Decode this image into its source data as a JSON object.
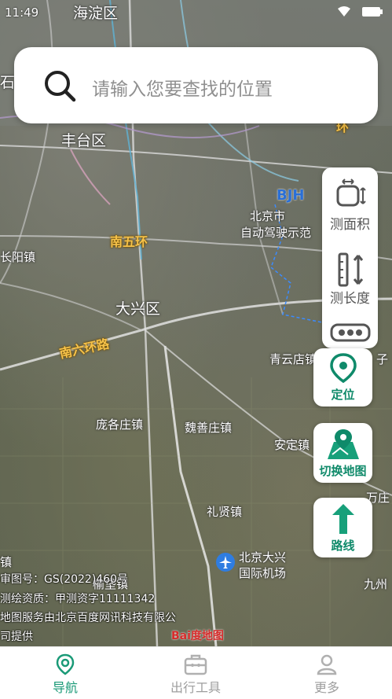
{
  "status_bar": {
    "time": "11:49"
  },
  "search": {
    "placeholder": "请输入您要查找的位置",
    "icon": "search-icon"
  },
  "map_labels": {
    "haidian": "海淀区",
    "fengtai": "丰台区",
    "nanwuhuan": "南五环",
    "daxing": "大兴区",
    "nanliuhuan": "南六环路",
    "changyang": "长阳镇",
    "panggezhuang": "庞各庄镇",
    "weishanzhuang": "魏善庄镇",
    "anding": "安定镇",
    "lixian": "礼贤镇",
    "airport_line1": "北京大兴",
    "airport_line2": "国际机场",
    "yufa": "榆垡镇",
    "qingyundian": "青云店镇",
    "wanzhuang": "万庄",
    "jiuzhou": "九州",
    "beijing_city": "北京市",
    "autodrive": "自动驾驶示范",
    "bjh": "BJH",
    "zhen": "镇",
    "zi": "子",
    "huan": "环",
    "shi": "石"
  },
  "tools": [
    {
      "label": "测面积",
      "icon": "measure-area-icon"
    },
    {
      "label": "测长度",
      "icon": "measure-length-icon"
    },
    {
      "label": "more",
      "icon": "more-dots-icon"
    }
  ],
  "actions": {
    "locate": "定位",
    "switch_map": "切换地图",
    "route": "路线"
  },
  "legal": {
    "approval": "审图号：GS(2022)460号",
    "qualification": "测绘资质：甲测资字11111342",
    "service": "地图服务由北京百度网讯科技有限公",
    "service2": "司提供",
    "baidu_logo": "Bai度地图"
  },
  "tabs": [
    {
      "label": "导航",
      "icon": "navigation-pin-icon",
      "active": true
    },
    {
      "label": "出行工具",
      "icon": "toolbox-icon",
      "active": false
    },
    {
      "label": "更多",
      "icon": "person-icon",
      "active": false
    }
  ],
  "colors": {
    "accent": "#1a9a77",
    "ring_road": "#f6c24a"
  }
}
